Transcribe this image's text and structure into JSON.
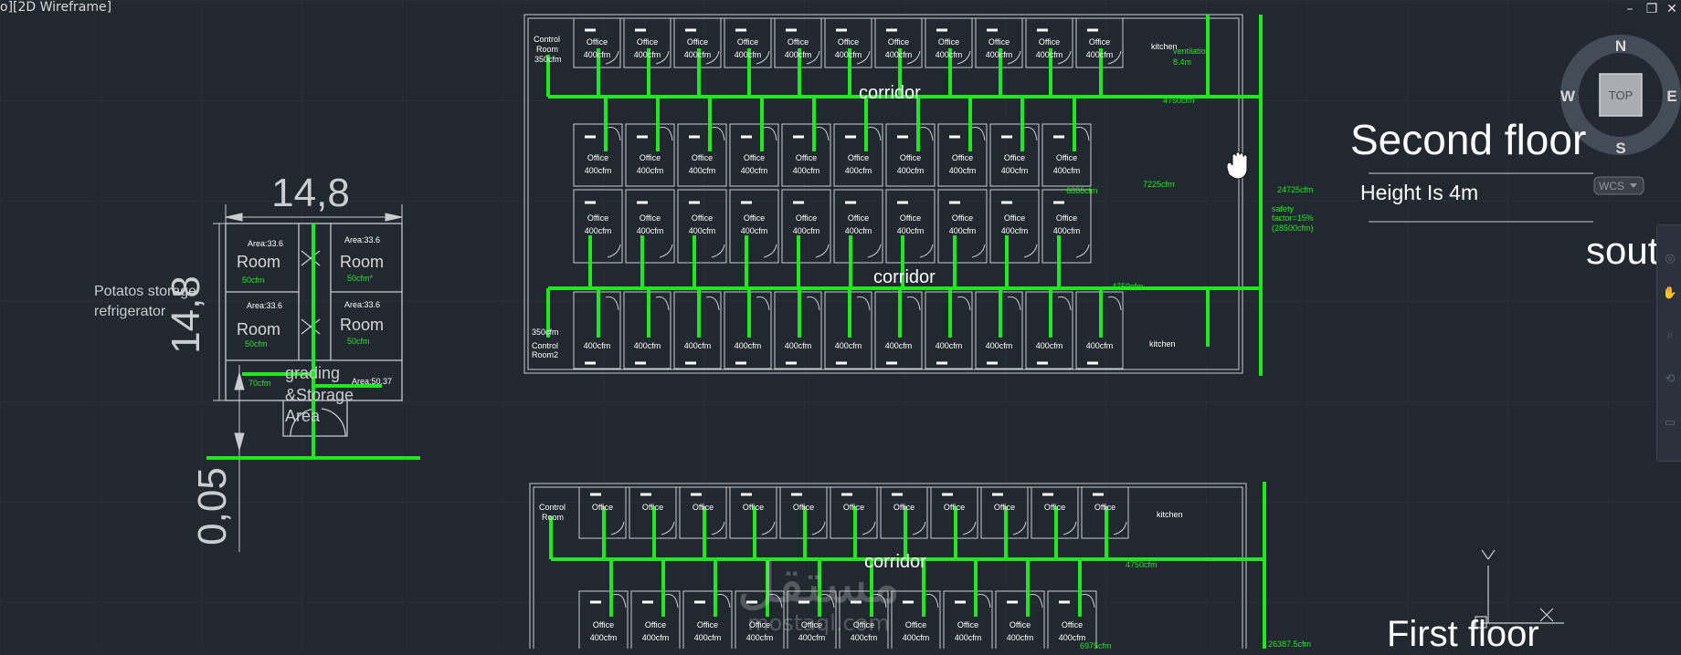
{
  "viewport": {
    "label": "o][2D Wireframe]"
  },
  "window_controls": {
    "minimize": "–",
    "restore": "❐",
    "close": "✕"
  },
  "viewcube": {
    "n": "N",
    "s": "S",
    "e": "E",
    "w": "W",
    "top": "TOP",
    "wcs": "WCS"
  },
  "titles": {
    "second_floor": "Second floor",
    "height": "Height Is 4m",
    "south": "south",
    "first_floor": "First floor"
  },
  "ucs": {
    "y": "Y"
  },
  "storage": {
    "width_dim": "14,8",
    "height_dim": "14,8",
    "small_dim": "0,05",
    "caption_line1": "Potatos storage",
    "caption_line2": "refrigerator",
    "rooms": [
      {
        "area": "Area:33.6",
        "name": "Room",
        "flow": "50cfm"
      },
      {
        "area": "Area:33.6",
        "name": "Room",
        "flow": "50cfm*"
      },
      {
        "area": "Area:33.6",
        "name": "Room",
        "flow": "50cfm"
      },
      {
        "area": "Area:33.6",
        "name": "Room",
        "flow": "50cfm"
      }
    ],
    "grading_line1": "grading",
    "grading_line2": "&Storage",
    "grading_line3": "Area",
    "grading_area": "Area:50.37",
    "grading_flow": "70cfm"
  },
  "plan2": {
    "corridor": "corridor",
    "office": "Office",
    "flow": "400cfm",
    "control1_l1": "Control",
    "control1_l2": "Room",
    "control1_flow": "350cfm",
    "control2_l1": "Control",
    "control2_l2": "Room2",
    "control2_flow": "350cfm",
    "kitchen_top": "kitchen",
    "kitchen_bottom": "kitchen",
    "ventilation_l1": "ventilation",
    "ventilation_l2": "8.4m",
    "main_flow": "24725cfm",
    "safety_l1": "safety",
    "safety_l2": "factor=15%",
    "safety_l3": "(28500cfm)",
    "branch_top": "4750cfm",
    "branch_bottom": "4750cfm",
    "branch_mid": "7225cfm",
    "branch_left": "6886cfm"
  },
  "plan1": {
    "corridor": "corridor",
    "office": "Office",
    "flow": "400cfm",
    "control_l1": "Control",
    "control_l2": "Room",
    "kitchen": "kitchen",
    "branch_top": "4750cfm",
    "main_flow": "26387.5cfm",
    "branch_bottom": "6975cfm"
  },
  "watermark": {
    "arabic": "مستقل",
    "latin": "mostaql.com"
  },
  "colors": {
    "background": "#212830",
    "duct": "#1fe81f",
    "wall": "#c9ccd0",
    "text": "#ffffff"
  }
}
